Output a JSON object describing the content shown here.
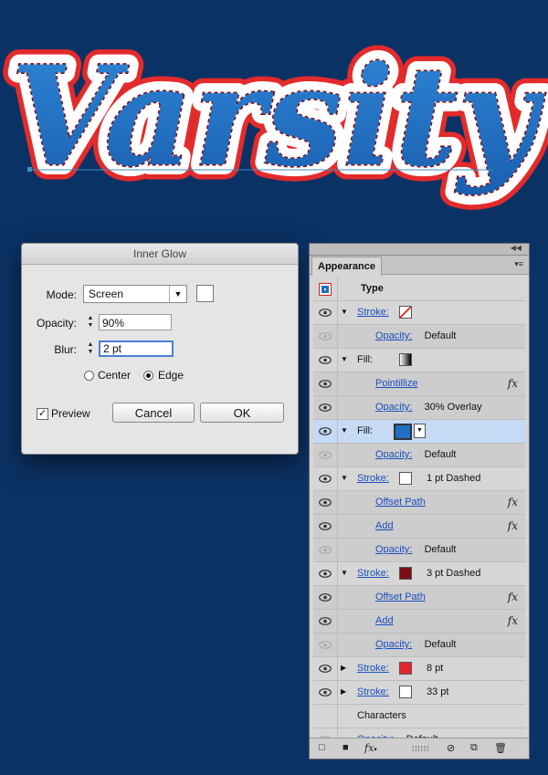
{
  "artwork": {
    "wordmark": "Varsity",
    "colors": {
      "background": "#0b3265",
      "fill": "#1f6fc2",
      "outer_stroke": "#e32b2b",
      "white_stroke": "#ffffff"
    }
  },
  "dialog": {
    "title": "Inner Glow",
    "mode_label": "Mode:",
    "mode_value": "Screen",
    "opacity_label": "Opacity:",
    "opacity_value": "90%",
    "blur_label": "Blur:",
    "blur_value": "2 pt",
    "radio_center": "Center",
    "radio_edge": "Edge",
    "selected_radio": "Edge",
    "preview_label": "Preview",
    "preview_checked": true,
    "cancel_label": "Cancel",
    "ok_label": "OK"
  },
  "panel": {
    "tab": "Appearance",
    "rows": [
      {
        "type": "header",
        "text": "Type"
      },
      {
        "tri": "down",
        "link": "Stroke:",
        "swatch": "none-slash",
        "eye": true
      },
      {
        "indent": true,
        "link": "Opacity:",
        "value": "Default",
        "eye": false
      },
      {
        "tri": "down",
        "label": "Fill:",
        "swatch": "gradient",
        "eye": true
      },
      {
        "indent": true,
        "link": "Pointillize",
        "fx": true,
        "eye": true
      },
      {
        "indent": true,
        "link": "Opacity:",
        "value": "30% Overlay",
        "eye": true
      },
      {
        "tri": "down",
        "label": "Fill:",
        "swatch": "blue-dropdown",
        "selected": true,
        "eye": true
      },
      {
        "indent": true,
        "link": "Opacity:",
        "value": "Default",
        "eye": false
      },
      {
        "tri": "down",
        "link": "Stroke:",
        "swatch": "white",
        "value": "1 pt Dashed",
        "eye": true
      },
      {
        "indent": true,
        "link": "Offset Path",
        "fx": true,
        "eye": true
      },
      {
        "indent": true,
        "link": "Add",
        "fx": true,
        "eye": true
      },
      {
        "indent": true,
        "link": "Opacity:",
        "value": "Default",
        "eye": false
      },
      {
        "tri": "down",
        "link": "Stroke:",
        "swatch": "darkred",
        "value": "3 pt Dashed",
        "eye": true
      },
      {
        "indent": true,
        "link": "Offset Path",
        "fx": true,
        "eye": true
      },
      {
        "indent": true,
        "link": "Add",
        "fx": true,
        "eye": true
      },
      {
        "indent": true,
        "link": "Opacity:",
        "value": "Default",
        "eye": false
      },
      {
        "tri": "right",
        "link": "Stroke:",
        "swatch": "red",
        "value": "8 pt",
        "eye": true
      },
      {
        "tri": "right",
        "link": "Stroke:",
        "swatch": "white",
        "value": "33 pt",
        "eye": true
      },
      {
        "label": "Characters",
        "eye": null
      },
      {
        "plain": true,
        "link": "Opacity:",
        "value": "Default",
        "eye": false
      }
    ],
    "fx_glyph": "fx",
    "swatch_colors": {
      "white": "#ffffff",
      "darkred": "#7a0e16",
      "red": "#e4252c",
      "blue-dropdown": "#1f6fc2"
    }
  }
}
